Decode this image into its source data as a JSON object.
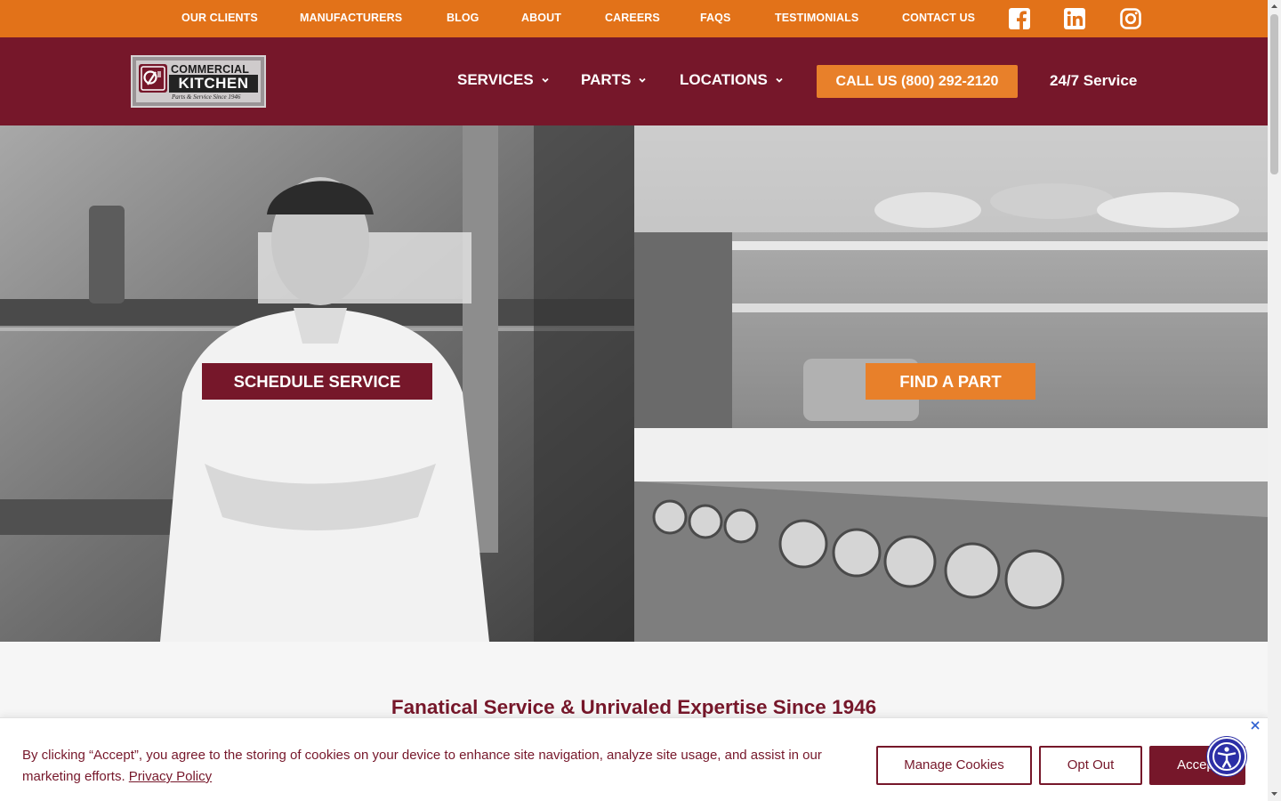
{
  "topbar": {
    "links": [
      "OUR CLIENTS",
      "MANUFACTURERS",
      "BLOG",
      "ABOUT",
      "CAREERS",
      "FAQS",
      "TESTIMONIALS",
      "CONTACT US"
    ],
    "social": [
      "facebook-icon",
      "linkedin-icon",
      "instagram-icon"
    ],
    "color": "#e27219"
  },
  "header": {
    "logo": {
      "line1": "COMMERCIAL",
      "line2": "KITCHEN",
      "line3": "Parts & Service Since 1946"
    },
    "nav": [
      {
        "label": "SERVICES",
        "icon": "chevron-down-icon"
      },
      {
        "label": "PARTS",
        "icon": "chevron-down-icon"
      },
      {
        "label": "LOCATIONS",
        "icon": "chevron-down-icon"
      }
    ],
    "call_label": "CALL US (800) 292-2120",
    "service_label": "24/7 Service",
    "color": "#76172a",
    "accent": "#e8802a"
  },
  "hero": {
    "left_button": "SCHEDULE SERVICE",
    "right_button": "FIND A PART"
  },
  "section": {
    "title": "Fanatical Service & Unrivaled Expertise Since 1946"
  },
  "cookie": {
    "text": "By clicking “Accept”, you agree to the storing of cookies on your device to enhance site navigation, analyze site usage, and assist in our marketing efforts.",
    "privacy_link": "Privacy Policy",
    "manage_label": "Manage Cookies",
    "optout_label": "Opt Out",
    "accept_label": "Accept"
  }
}
